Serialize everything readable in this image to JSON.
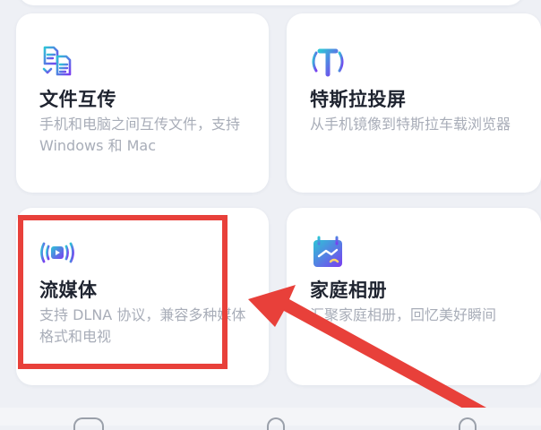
{
  "cards": [
    {
      "title": "文件互传",
      "description": "手机和电脑之间互传文件，支持 Windows 和 Mac",
      "icon": "file-transfer-icon"
    },
    {
      "title": "特斯拉投屏",
      "description": "从手机镜像到特斯拉车载浏览器",
      "icon": "tesla-cast-icon"
    },
    {
      "title": "流媒体",
      "description": "支持 DLNA 协议，兼容多种媒体格式和电视",
      "icon": "streaming-icon"
    },
    {
      "title": "家庭相册",
      "description": "汇聚家庭相册，回忆美好瞬间",
      "icon": "family-album-icon"
    }
  ],
  "colors": {
    "icon_gradient_start": "#2ec4d6",
    "icon_gradient_end": "#7a3df0",
    "annotation_red": "#e8403a",
    "background": "#eef0f5"
  }
}
